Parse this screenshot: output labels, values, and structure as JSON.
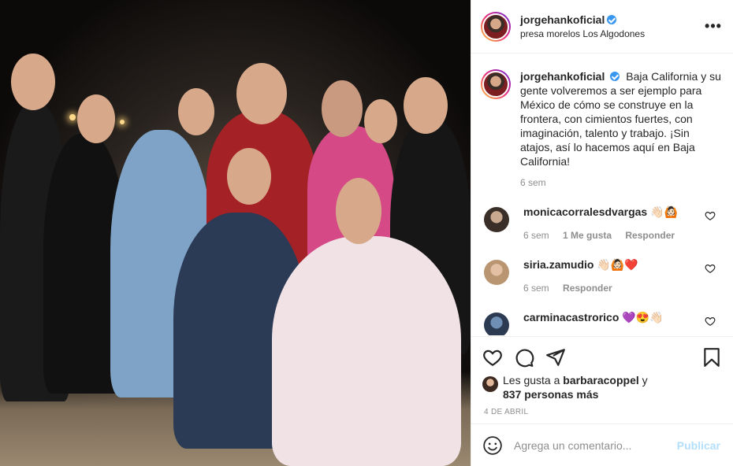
{
  "post": {
    "username": "jorgehankoficial",
    "location": "presa morelos Los Algodones",
    "more_label": "•••"
  },
  "caption": {
    "username": "jorgehankoficial",
    "text": "Baja California y su gente volveremos a ser ejemplo para México de cómo se construye en la frontera, con cimientos fuertes, con imaginación, talento y trabajo. ¡Sin atajos, así lo hacemos aquí en Baja California!",
    "time": "6 sem"
  },
  "comments": [
    {
      "username": "monicacorralesdvargas",
      "emoji": "👋🏻🙆🏻",
      "time": "6 sem",
      "likes": "1 Me gusta",
      "reply": "Responder"
    },
    {
      "username": "siria.zamudio",
      "emoji": "👋🏻🙆🏻❤️",
      "time": "6 sem",
      "reply": "Responder"
    },
    {
      "username": "carminacastrorico",
      "emoji": "💜😍👋🏻"
    }
  ],
  "likes": {
    "prefix": "Les gusta a",
    "user": "barbaracoppel",
    "connector": "y",
    "count": "837 personas más"
  },
  "date": "4 DE ABRIL",
  "add_comment": {
    "placeholder": "Agrega un comentario...",
    "publish": "Publicar"
  },
  "icons": {
    "more": "more-options-icon",
    "like": "heart-icon",
    "comment": "comment-icon",
    "share": "share-icon",
    "save": "bookmark-icon",
    "emoji": "emoji-icon"
  },
  "colors": {
    "verified": "#3897f0",
    "publish_disabled": "#b2dffc",
    "muted": "#8e8e8e"
  }
}
